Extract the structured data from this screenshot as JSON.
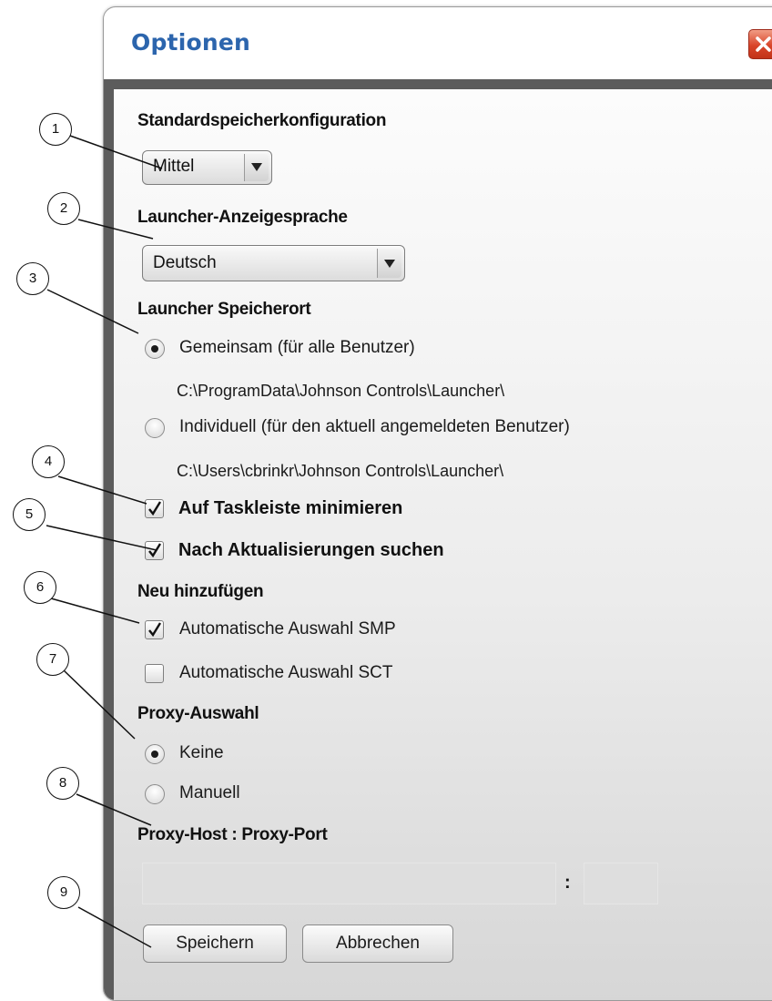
{
  "dialog": {
    "title": "Optionen",
    "close_label": "X"
  },
  "memory": {
    "heading": "Standardspeicherkonfiguration",
    "value": "Mittel"
  },
  "language": {
    "heading": "Launcher-Anzeigesprache",
    "value": "Deutsch"
  },
  "location": {
    "heading": "Launcher Speicherort",
    "shared_label": "Gemeinsam (für alle Benutzer)",
    "shared_path": "C:\\ProgramData\\Johnson Controls\\Launcher\\",
    "individual_label": "Individuell (für den aktuell angemeldeten Benutzer)",
    "individual_path": "C:\\Users\\cbrinkr\\Johnson Controls\\Launcher\\",
    "selected": "shared"
  },
  "options": {
    "minimize_label": "Auf Taskleiste minimieren",
    "minimize_checked": true,
    "updates_label": "Nach Aktualisierungen suchen",
    "updates_checked": true
  },
  "add_new": {
    "heading": "Neu hinzufügen",
    "smp_label": "Automatische Auswahl SMP",
    "smp_checked": true,
    "sct_label": "Automatische Auswahl SCT",
    "sct_checked": false
  },
  "proxy": {
    "heading": "Proxy-Auswahl",
    "none_label": "Keine",
    "manual_label": "Manuell",
    "selected": "none",
    "host_port_heading": "Proxy-Host : Proxy-Port",
    "separator": ":",
    "host_value": "",
    "port_value": ""
  },
  "buttons": {
    "save_label": "Speichern",
    "cancel_label": "Abbrechen"
  },
  "callouts": [
    "1",
    "2",
    "3",
    "4",
    "5",
    "6",
    "7",
    "8",
    "9"
  ],
  "colors": {
    "title": "#2c65ad",
    "close_button": "#d9452a",
    "frame": "#5c5c5c"
  }
}
